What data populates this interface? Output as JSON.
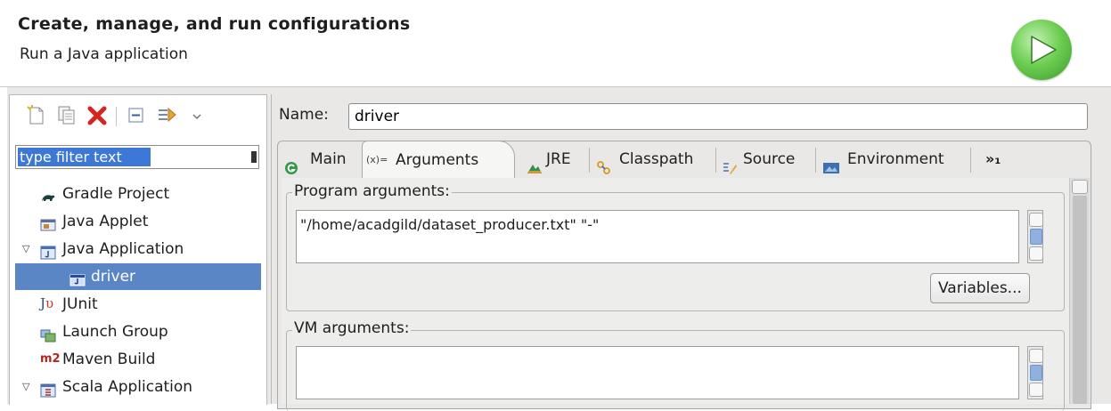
{
  "header": {
    "title": "Create, manage, and run configurations",
    "subtitle": "Run a Java application",
    "run_icon": "run-icon"
  },
  "left_panel": {
    "toolbar": [
      "new-config-icon",
      "duplicate-icon",
      "delete-icon",
      "collapse-all-icon",
      "filter-icon",
      "view-menu-icon"
    ],
    "filter_placeholder": "type filter text",
    "tree": [
      {
        "label": "Gradle Project",
        "icon": "gradle-icon",
        "expanded": null,
        "selected": false
      },
      {
        "label": "Java Applet",
        "icon": "java-applet-icon",
        "expanded": null,
        "selected": false
      },
      {
        "label": "Java Application",
        "icon": "java-application-icon",
        "expanded": true,
        "selected": false
      },
      {
        "label": "driver",
        "icon": "java-config-icon",
        "expanded": null,
        "selected": true
      },
      {
        "label": "JUnit",
        "icon": "junit-icon",
        "expanded": null,
        "selected": false
      },
      {
        "label": "Launch Group",
        "icon": "launch-group-icon",
        "expanded": null,
        "selected": false
      },
      {
        "label": "Maven Build",
        "icon": "maven-icon",
        "expanded": null,
        "selected": false
      },
      {
        "label": "Scala Application",
        "icon": "scala-application-icon",
        "expanded": true,
        "selected": false
      }
    ]
  },
  "config": {
    "name_label": "Name:",
    "name_value": "driver",
    "tabs": [
      {
        "label": "Main",
        "icon": "main-tab-icon",
        "active": false
      },
      {
        "label": "Arguments",
        "icon": "arguments-tab-icon",
        "active": true
      },
      {
        "label": "JRE",
        "icon": "jre-tab-icon",
        "active": false
      },
      {
        "label": "Classpath",
        "icon": "classpath-tab-icon",
        "active": false
      },
      {
        "label": "Source",
        "icon": "source-tab-icon",
        "active": false
      },
      {
        "label": "Environment",
        "icon": "environment-tab-icon",
        "active": false
      }
    ],
    "tabs_overflow_label": "»₁",
    "program_args": {
      "title": "Program arguments:",
      "value": "\"/home/acadgild/dataset_producer.txt\" \"-\"",
      "variables_button": "Variables..."
    },
    "vm_args": {
      "title": "VM arguments:",
      "value": ""
    }
  },
  "colors": {
    "selection": "#5b86c6",
    "filter_highlight": "#3d78d6",
    "run_green": "#4fb83a",
    "delete_red": "#d8231f"
  }
}
